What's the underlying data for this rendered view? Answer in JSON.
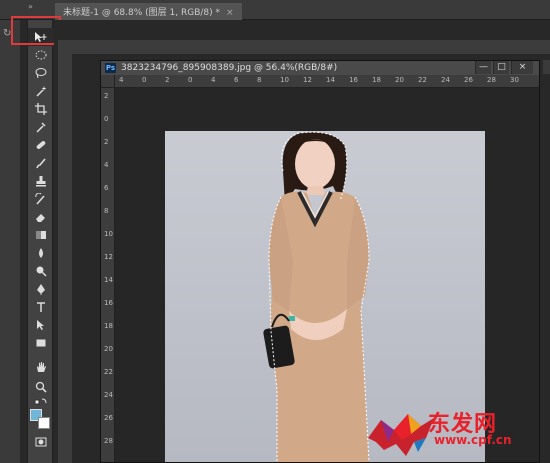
{
  "app": {
    "collapse_glyph": "»",
    "rotate_glyph": "↻"
  },
  "tabs": [
    {
      "label": "未标题-1 @ 68.8% (图层 1, RGB/8) *",
      "close": "×"
    }
  ],
  "document": {
    "title": "3823234796_895908389.jpg @ 56.4%(RGB/8#)",
    "app_badge": "Ps",
    "minimize": "—",
    "maximize": "□",
    "close": "×"
  },
  "ruler_h": [
    "4",
    "0",
    "2",
    "0",
    "4",
    "6",
    "8",
    "10",
    "12",
    "14",
    "16",
    "18",
    "20",
    "22",
    "24",
    "26",
    "28",
    "30"
  ],
  "ruler_v": [
    "2",
    "0",
    "2",
    "4",
    "6",
    "8",
    "10",
    "12",
    "14",
    "16",
    "18",
    "20",
    "22",
    "24",
    "26",
    "28"
  ],
  "tools": [
    {
      "name": "move-tool"
    },
    {
      "name": "marquee-tool"
    },
    {
      "name": "lasso-tool"
    },
    {
      "name": "magic-wand-tool"
    },
    {
      "name": "crop-tool"
    },
    {
      "name": "eyedropper-tool"
    },
    {
      "name": "healing-brush-tool"
    },
    {
      "name": "brush-tool"
    },
    {
      "name": "clone-stamp-tool"
    },
    {
      "name": "history-brush-tool"
    },
    {
      "name": "eraser-tool"
    },
    {
      "name": "gradient-tool"
    },
    {
      "name": "blur-tool"
    },
    {
      "name": "dodge-tool"
    },
    {
      "name": "pen-tool"
    },
    {
      "name": "type-tool"
    },
    {
      "name": "path-selection-tool"
    },
    {
      "name": "rectangle-tool"
    },
    {
      "name": "hand-tool"
    },
    {
      "name": "zoom-tool"
    }
  ],
  "colors": {
    "foreground": "#6fb6d8",
    "background": "#ffffff",
    "highlight": "#e03a3a"
  },
  "watermark": {
    "brand": "东发网",
    "url": "www.cpf.cn"
  }
}
